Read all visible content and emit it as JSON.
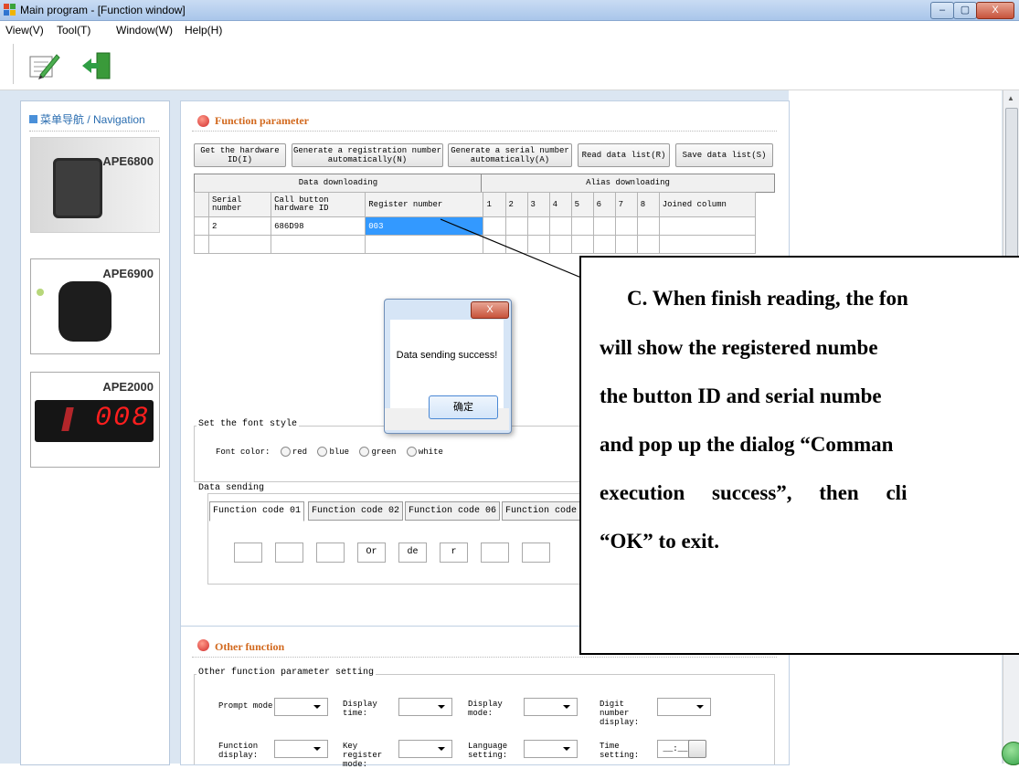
{
  "window": {
    "title": "Main program - [Function window]",
    "min": "–",
    "max": "▢",
    "close": "X"
  },
  "menu": [
    "View(V)",
    "Tool(T)",
    "Window(W)",
    "Help(H)"
  ],
  "toolbar": {
    "icons": [
      "edit-icon",
      "exit-icon"
    ]
  },
  "nav": {
    "title": "菜单导航 / Navigation",
    "items": [
      {
        "label": "APE6800"
      },
      {
        "label": "APE6900"
      },
      {
        "label": "APE2000",
        "display": "008"
      }
    ]
  },
  "function_parameter": {
    "title": "Function parameter",
    "buttons": [
      "Get the hardware ID(I)",
      "Generate a registration number automatically(N)",
      "Generate a serial number automatically(A)",
      "Read data list(R)",
      "Save data list(S)"
    ],
    "bands": [
      "Data downloading",
      "Alias downloading"
    ],
    "columns": [
      "Serial number",
      "Call button hardware ID",
      "Register number",
      "1",
      "2",
      "3",
      "4",
      "5",
      "6",
      "7",
      "8",
      "Joined column"
    ],
    "rows": [
      {
        "serial": "2",
        "hardware_id": "686D98",
        "register": "003"
      }
    ],
    "font_style": {
      "legend": "Set the font style",
      "label": "Font color:",
      "options": [
        "red",
        "blue",
        "green",
        "white"
      ]
    },
    "data_sending": {
      "legend": "Data sending",
      "tabs": [
        "Function code 01",
        "Function code 02",
        "Function code 06",
        "Function code"
      ],
      "boxes": [
        "",
        "",
        "",
        "Or",
        "de",
        "r",
        "",
        ""
      ]
    }
  },
  "other_function": {
    "title": "Other function",
    "legend": "Other function parameter setting",
    "fields": [
      "Prompt mode:",
      "Display time:",
      "Display mode:",
      "Digit number display:",
      "Function display:",
      "Key register mode:",
      "Language setting:",
      "Time setting:"
    ],
    "time_value": "__:__"
  },
  "dialog": {
    "message": "Data sending success!",
    "ok": "确定",
    "close": "X"
  },
  "callout": {
    "lines": [
      "C. When finish reading, the fon",
      "will show the registered numbe",
      "the button ID and serial numbe",
      "and pop up the dialog “Comman",
      "execution success”, then cli",
      "“OK” to exit."
    ]
  },
  "colors": {
    "accent": "#d2691e",
    "selection": "#3399ff",
    "nav_text": "#2a6db0"
  }
}
